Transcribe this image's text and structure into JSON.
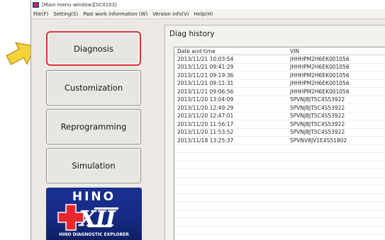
{
  "window": {
    "title": "[Main menu window][SC0103]"
  },
  "menubar": {
    "items": [
      {
        "label": "File(F)"
      },
      {
        "label": "Setting(S)"
      },
      {
        "label": "Past work information (W)"
      },
      {
        "label": "Version info(V)"
      },
      {
        "label": "Help(H)"
      }
    ]
  },
  "sidebar": {
    "buttons": [
      {
        "label": "Diagnosis"
      },
      {
        "label": "Customization"
      },
      {
        "label": "Reprogramming"
      },
      {
        "label": "Simulation"
      }
    ]
  },
  "logo": {
    "brand": "HINO",
    "mark": "DXII",
    "tagline": "HINO DIAGNOSTIC EXPLORER",
    "colors": {
      "background": "#1a2f91",
      "accent": "#e8262d"
    }
  },
  "history": {
    "title": "Diag history",
    "columns": [
      "Date and time",
      "VIN"
    ],
    "rows": [
      [
        "2013/11/21 10:03:54",
        "JHHHPM2H6EK001056"
      ],
      [
        "2013/11/21 09:41:29",
        "JHHHPM2H6EK001056"
      ],
      [
        "2013/11/21 09:19:36",
        "JHHHPM2H6EK001056"
      ],
      [
        "2013/11/21 09:11:31",
        "JHHHPM2H6EK001056"
      ],
      [
        "2013/11/21 09:06:56",
        "JHHHPM2H6EK001056"
      ],
      [
        "2013/11/20 13:04:09",
        "5PVNJ8JT5C4S53922"
      ],
      [
        "2013/11/20 12:49:29",
        "5PVNJ8JT5C4S53922"
      ],
      [
        "2013/11/20 12:47:01",
        "5PVNJ8JT5C4S53922"
      ],
      [
        "2013/11/20 11:56:17",
        "5PVNJ8JT5C4S53922"
      ],
      [
        "2013/11/20 11:53:52",
        "5PVNJ8JT5C4S53922"
      ],
      [
        "2013/11/18 13:25:37",
        "5PVNV8JV1E4S51802"
      ]
    ]
  },
  "colors": {
    "selected_border": "#d9363a",
    "pointer_fill": "#f5d43a"
  }
}
